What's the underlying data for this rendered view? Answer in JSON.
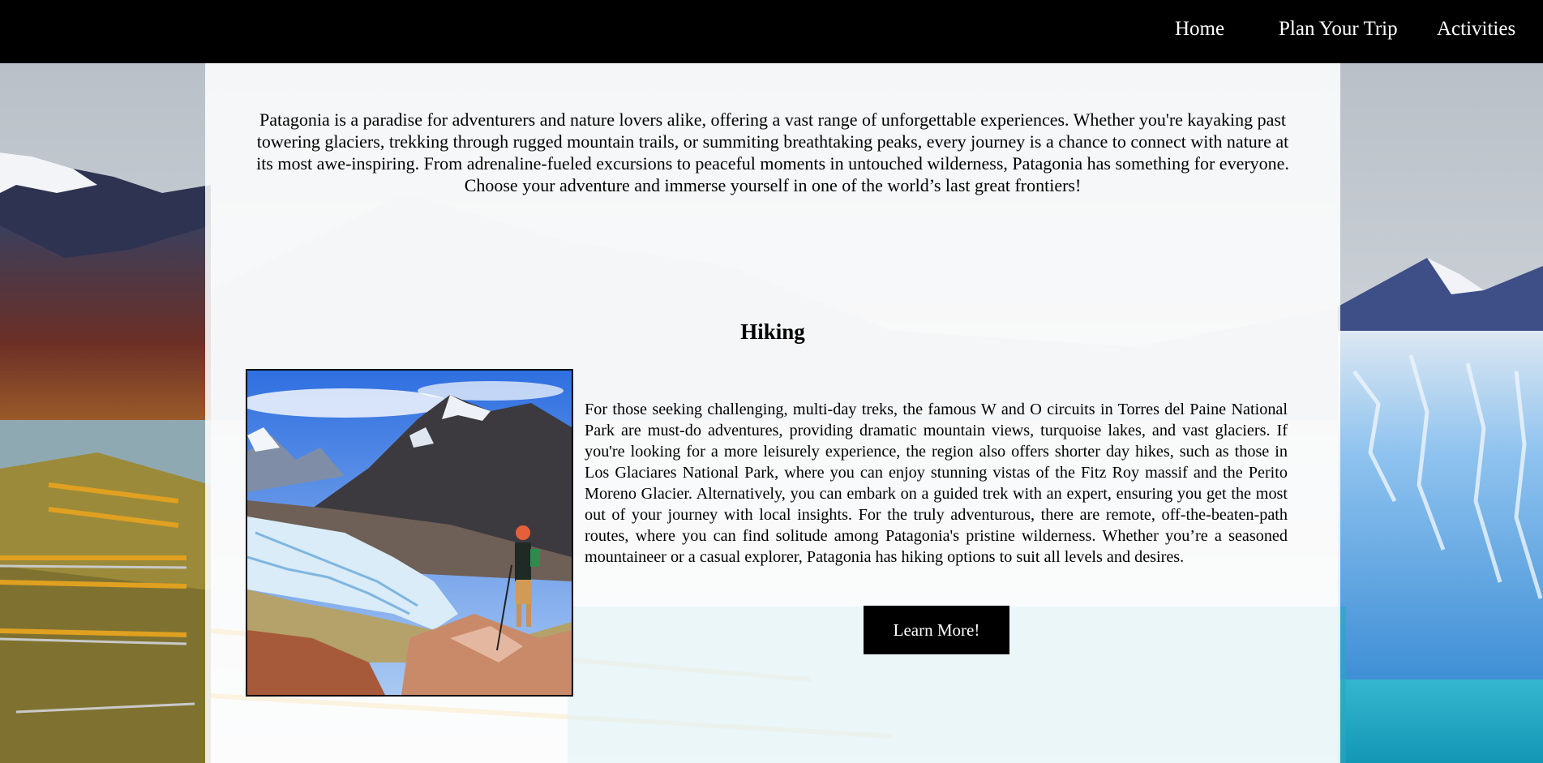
{
  "nav": {
    "home": "Home",
    "plan": "Plan Your Trip",
    "activities": "Activities"
  },
  "intro": "Patagonia is a paradise for adventurers and nature lovers alike, offering a vast range of unforgettable experiences. Whether you're kayaking past towering glaciers, trekking through rugged mountain trails, or summiting breathtaking peaks, every journey is a chance to connect with nature at its most awe-inspiring. From adrenaline-fueled excursions to peaceful moments in untouched wilderness, Patagonia has something for everyone. Choose your adventure and immerse yourself in one of the world’s last great frontiers!",
  "hiking": {
    "title": "Hiking",
    "text": "For those seeking challenging, multi-day treks, the famous W and O circuits in Torres del Paine National Park are must-do adventures, providing dramatic mountain views, turquoise lakes, and vast glaciers. If you're looking for a more leisurely experience, the region also offers shorter day hikes, such as those in Los Glaciares National Park, where you can enjoy stunning vistas of the Fitz Roy massif and the Perito Moreno Glacier. Alternatively, you can embark on a guided trek with an expert, ensuring you get the most out of your journey with local insights. For the truly adventurous, there are remote, off-the-beaten-path routes, where you can find solitude among Patagonia's pristine wilderness. Whether you’re a seasoned mountaineer or a casual explorer, Patagonia has hiking options to suit all levels and desires.",
    "button": "Learn More!"
  },
  "colors": {
    "nav_bg": "#000000",
    "nav_text": "#ffffff",
    "button_bg": "#000000",
    "button_text": "#ffffff",
    "glacier": "#6fb2ea",
    "lake": "#1fa8c4"
  }
}
